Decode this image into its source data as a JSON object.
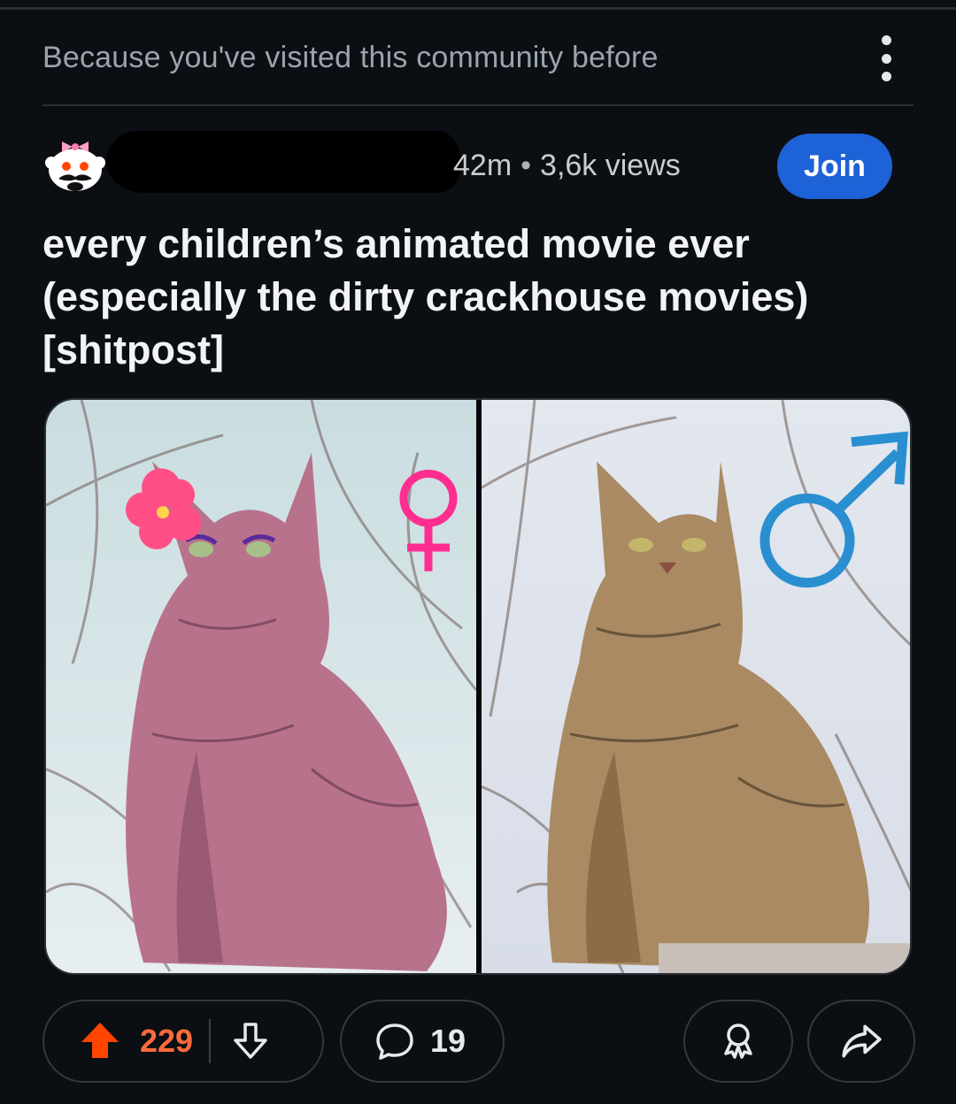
{
  "feed": {
    "recommendation_reason": "Because you've visited this community before",
    "overflow_icon": "vertical-dots-icon"
  },
  "post": {
    "community_avatar_icon": "mustache-snoo-with-bow-icon",
    "age": "42m",
    "separator": "•",
    "views": "3,6k views",
    "join_label": "Join",
    "title": "every children’s animated movie ever (especially the dirty crackhouse movies) [shitpost]",
    "images": [
      {
        "subject": "pink tabby cat with flower and eyeliner",
        "symbol": "female-symbol",
        "symbol_color": "#ff2d8f"
      },
      {
        "subject": "brown tabby cat",
        "symbol": "male-symbol",
        "symbol_color": "#2a8fd0"
      }
    ]
  },
  "actions": {
    "upvote_icon": "upvote-arrow-icon",
    "score": "229",
    "downvote_icon": "downvote-arrow-icon",
    "comment_icon": "comment-bubble-icon",
    "comments": "19",
    "award_icon": "award-icon",
    "share_icon": "share-icon"
  },
  "colors": {
    "background": "#0b0e12",
    "join_button": "#1d62d6",
    "upvote_active": "#ff4500",
    "score": "#ff6a3d"
  }
}
